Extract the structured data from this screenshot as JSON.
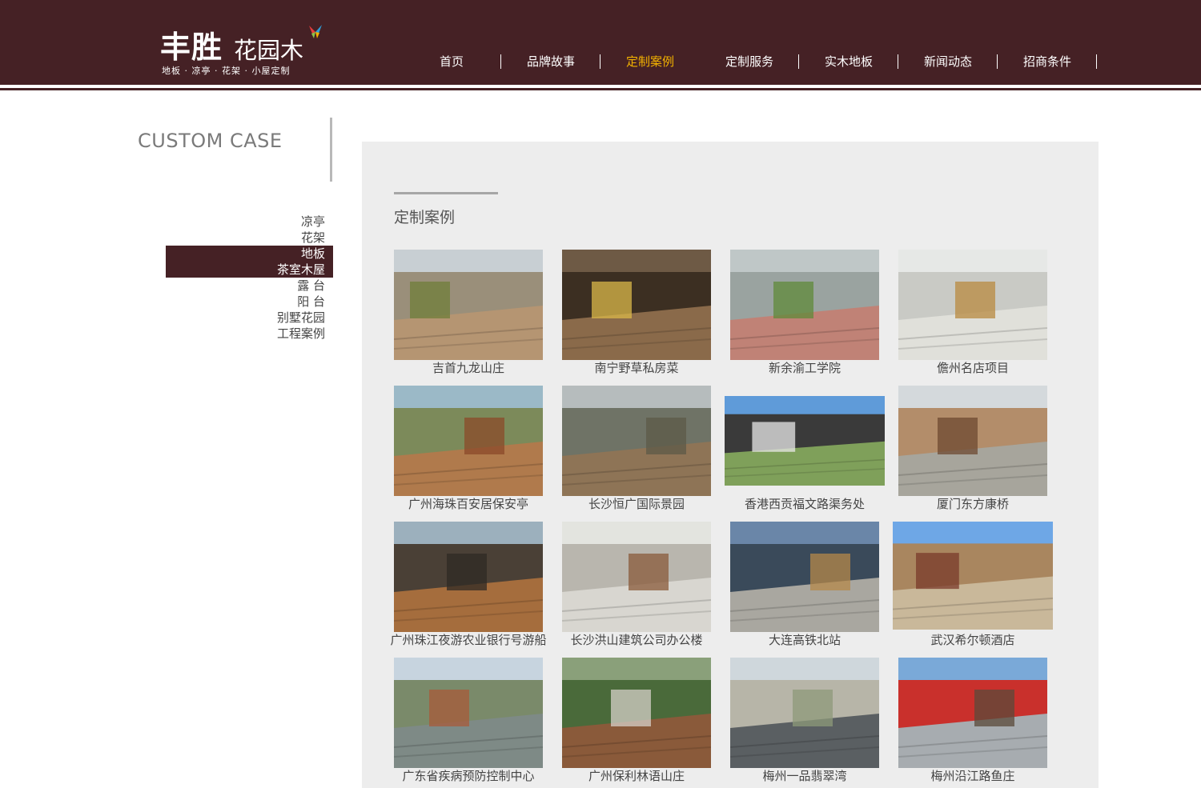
{
  "header": {
    "logo_main": "丰胜",
    "logo_sub": "花园木",
    "logo_tag": "地板 · 凉亭 · 花架 · 小屋定制",
    "brand_color": "#452125",
    "active_color": "#f3b200"
  },
  "nav": [
    {
      "label": "首页"
    },
    {
      "label": "品牌故事"
    },
    {
      "label": "定制案例"
    },
    {
      "label": "定制服务"
    },
    {
      "label": "实木地板"
    },
    {
      "label": "新闻动态"
    },
    {
      "label": "招商条件"
    }
  ],
  "sidebar": {
    "title": "CUSTOM CASE",
    "items": [
      {
        "label": "凉亭"
      },
      {
        "label": "花架"
      },
      {
        "label": "地板"
      },
      {
        "label": "茶室木屋"
      },
      {
        "label": "露 台"
      },
      {
        "label": "阳 台"
      },
      {
        "label": "别墅花园"
      },
      {
        "label": "工程案例"
      }
    ]
  },
  "main": {
    "title": "定制案例",
    "cases": [
      {
        "caption": "吉首九龙山庄",
        "icon": "wood-deck-railing-photo"
      },
      {
        "caption": "南宁野草私房菜",
        "icon": "restaurant-storefront-photo"
      },
      {
        "caption": "新余渝工学院",
        "icon": "rooftop-garden-photo"
      },
      {
        "caption": "儋州名店项目",
        "icon": "wooden-fence-photo"
      },
      {
        "caption": "广州海珠百安居保安亭",
        "icon": "guard-booth-photo"
      },
      {
        "caption": "长沙恒广国际景园",
        "icon": "pond-boardwalk-photo"
      },
      {
        "caption": "香港西贡福文路渠务处",
        "icon": "steel-pergola-photo"
      },
      {
        "caption": "厦门东方康桥",
        "icon": "garden-pavilion-photo"
      },
      {
        "caption": "广州珠江夜游农业银行号游船",
        "icon": "boat-deck-photo"
      },
      {
        "caption": "长沙洪山建筑公司办公楼",
        "icon": "office-balconies-photo"
      },
      {
        "caption": "大连高铁北站",
        "icon": "station-planters-photo"
      },
      {
        "caption": "武汉希尔顿酒店",
        "icon": "hotel-entrance-photo"
      },
      {
        "caption": "广东省疾病预防控制中心",
        "icon": "waterside-deck-photo"
      },
      {
        "caption": "广州保利林语山庄",
        "icon": "backyard-deck-photo"
      },
      {
        "caption": "梅州一品翡翠湾",
        "icon": "long-pergola-photo"
      },
      {
        "caption": "梅州沿江路鱼庄",
        "icon": "riverside-restaurant-photo"
      }
    ]
  }
}
